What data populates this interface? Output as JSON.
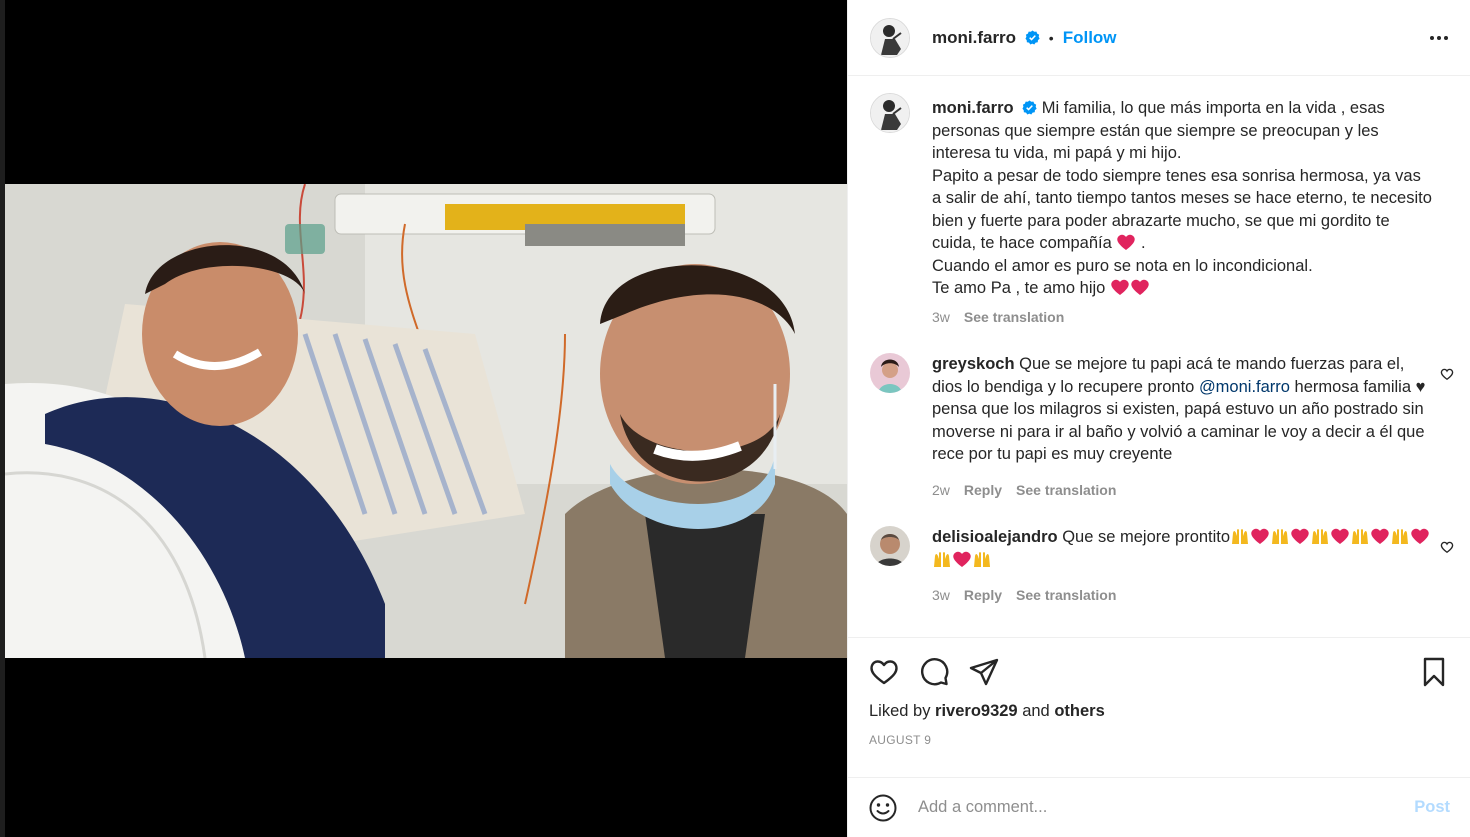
{
  "post": {
    "username": "moni.farro",
    "follow_label": "Follow",
    "separator": "•"
  },
  "caption": {
    "username": "moni.farro",
    "text": "Mi familia, lo que más importa en la vida , esas personas que siempre están que siempre se preocupan y les interesa tu vida, mi papá y mi hijo.\nPapito a pesar de todo siempre tenes esa sonrisa hermosa, ya vas a salir de ahí, tanto tiempo tantos meses se hace eterno, te necesito bien y fuerte para poder abrazarte mucho, se que mi gordito te cuida, te hace compañía",
    "after_heart": " .",
    "line_last_a": "Cuando el amor es puro se nota en lo incondicional.",
    "line_last_b": "Te amo Pa , te amo hijo",
    "time": "3w",
    "see_translation": "See translation"
  },
  "comments": [
    {
      "username": "greyskoch",
      "text_a": "Que se mejore tu papi acá te mando fuerzas para el, dios lo bendiga y lo recupere pronto ",
      "mention": "@moni.farro",
      "text_b": " hermosa familia ♥ pensa que los milagros si existen, papá estuvo un año postrado sin moverse ni para ir al baño y volvió a caminar le voy a decir a él que rece por tu papi es muy creyente",
      "time": "2w",
      "reply": "Reply",
      "see_translation": "See translation"
    },
    {
      "username": "delisioalejandro",
      "text": "Que se mejore prontito",
      "time": "3w",
      "reply": "Reply",
      "see_translation": "See translation"
    }
  ],
  "likes": {
    "prefix": "Liked by ",
    "user": "rivero9329",
    "and": " and ",
    "others": "others"
  },
  "date": "AUGUST 9",
  "composer": {
    "placeholder": "Add a comment...",
    "post_label": "Post"
  },
  "icons": {
    "like": "heart-icon",
    "comment": "comment-icon",
    "share": "share-icon",
    "save": "bookmark-icon",
    "emoji": "smile-icon",
    "more": "more-icon"
  },
  "colors": {
    "accent": "#0095f6",
    "post_disabled": "#b3dbff",
    "muted": "#8e8e8e",
    "heart": "#e0245e"
  }
}
